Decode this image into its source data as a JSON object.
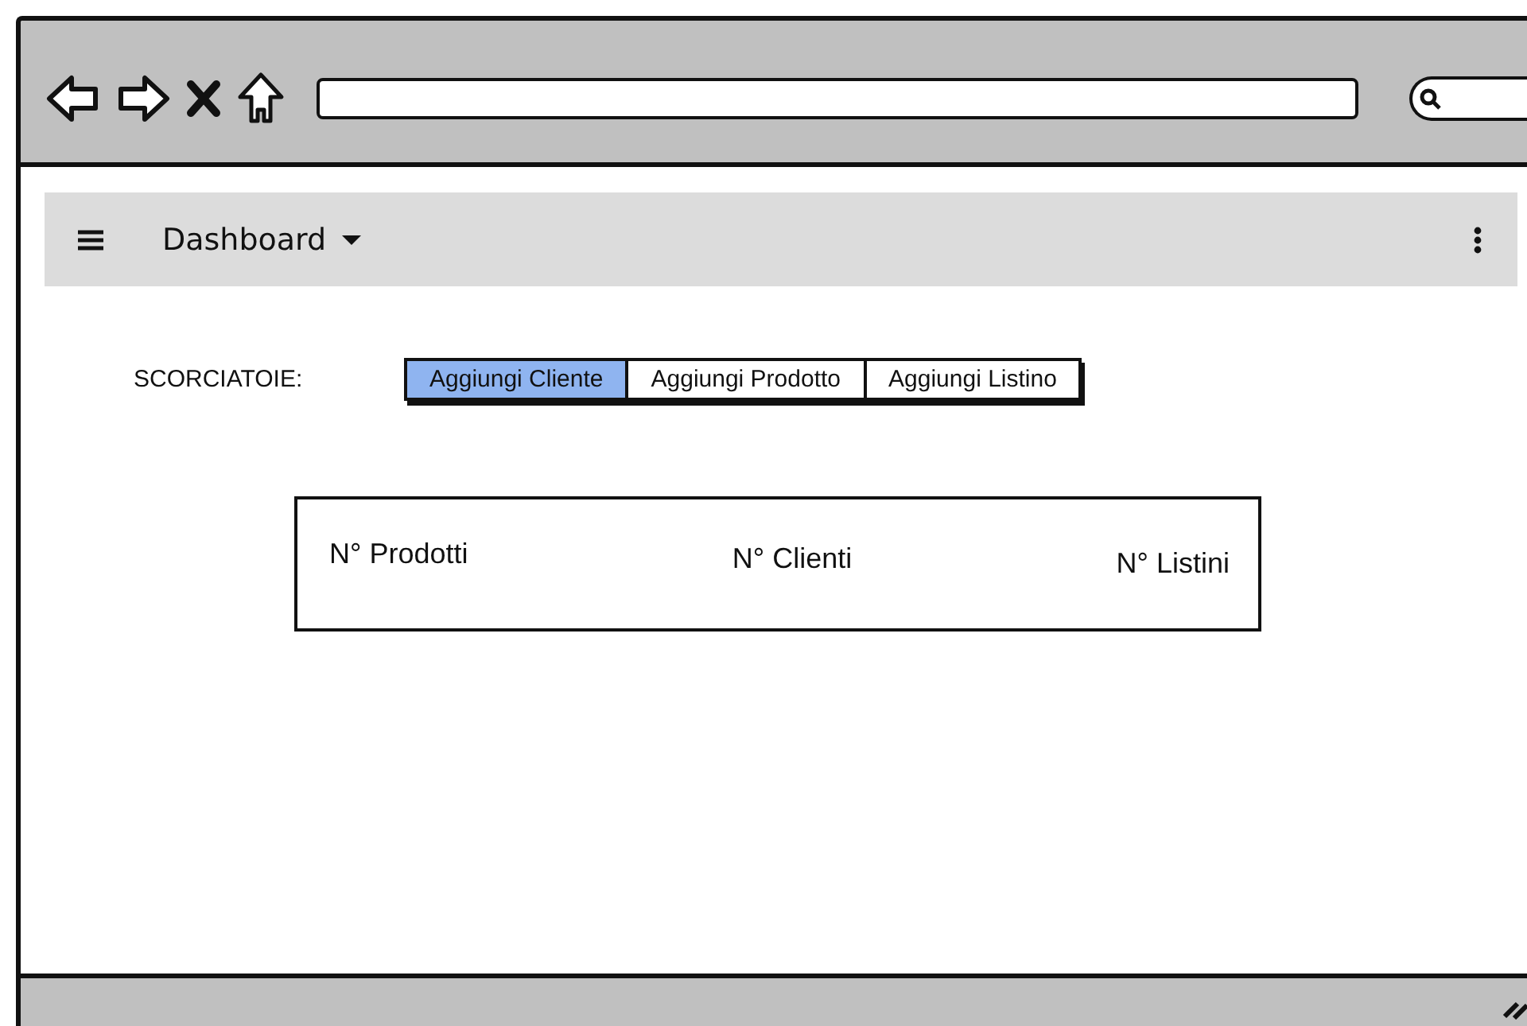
{
  "navbar": {
    "title": "Dashboard"
  },
  "shortcuts": {
    "label": "SCORCIATOIE:",
    "buttons": [
      {
        "label": "Aggiungi Cliente",
        "selected": true
      },
      {
        "label": "Aggiungi Prodotto",
        "selected": false
      },
      {
        "label": "Aggiungi Listino",
        "selected": false
      }
    ]
  },
  "stats": [
    "N° Prodotti",
    "N° Clienti",
    "N° Listini"
  ]
}
